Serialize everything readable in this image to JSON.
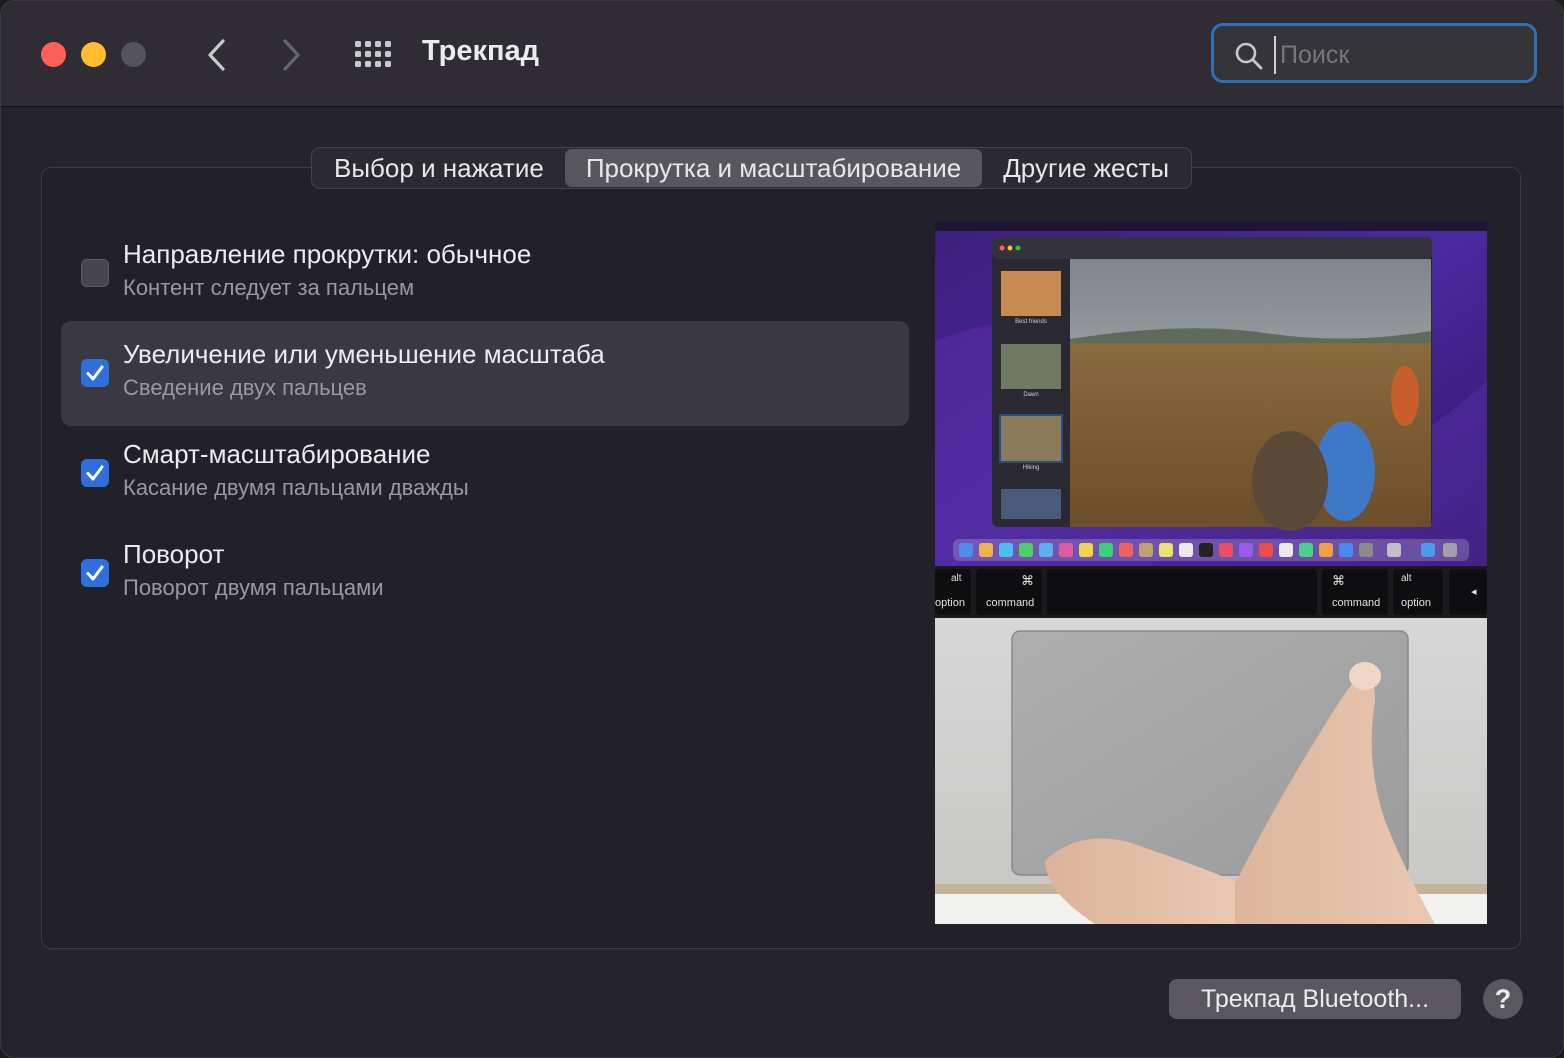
{
  "window": {
    "title": "Трекпад",
    "controls": [
      "close",
      "minimize",
      "zoom"
    ],
    "nav_icons": [
      "chevron-left-icon",
      "chevron-right-icon",
      "grid-icon"
    ]
  },
  "search": {
    "placeholder": "Поиск",
    "value": ""
  },
  "tabs": [
    {
      "label": "Выбор и нажатие",
      "active": false
    },
    {
      "label": "Прокрутка и масштабирование",
      "active": true
    },
    {
      "label": "Другие жесты",
      "active": false
    }
  ],
  "options": [
    {
      "title": "Направление прокрутки: обычное",
      "subtitle": "Контент следует за пальцем",
      "checked": false,
      "highlighted": false
    },
    {
      "title": "Увеличение или уменьшение масштаба",
      "subtitle": "Сведение двух пальцев",
      "checked": true,
      "highlighted": true
    },
    {
      "title": "Смарт-масштабирование",
      "subtitle": "Касание двумя пальцами дважды",
      "checked": true,
      "highlighted": false
    },
    {
      "title": "Поворот",
      "subtitle": "Поворот двумя пальцами",
      "checked": true,
      "highlighted": false
    }
  ],
  "preview": {
    "keys": [
      {
        "top": "alt",
        "bottom": "option"
      },
      {
        "top": "⌘",
        "bottom": "command"
      },
      {
        "top": "⌘",
        "bottom": "command"
      },
      {
        "top": "alt",
        "bottom": "option"
      },
      {
        "top": "",
        "bottom": "◂"
      }
    ],
    "sidebar_captions": [
      "Best friends",
      "Dawn",
      "Hiking"
    ]
  },
  "footer": {
    "bluetooth_button": "Трекпад Bluetooth...",
    "help_button": "?"
  },
  "colors": {
    "accent": "#2f6fdc",
    "focus_ring": "#2f6fb4",
    "window_bg": "#25232c"
  }
}
